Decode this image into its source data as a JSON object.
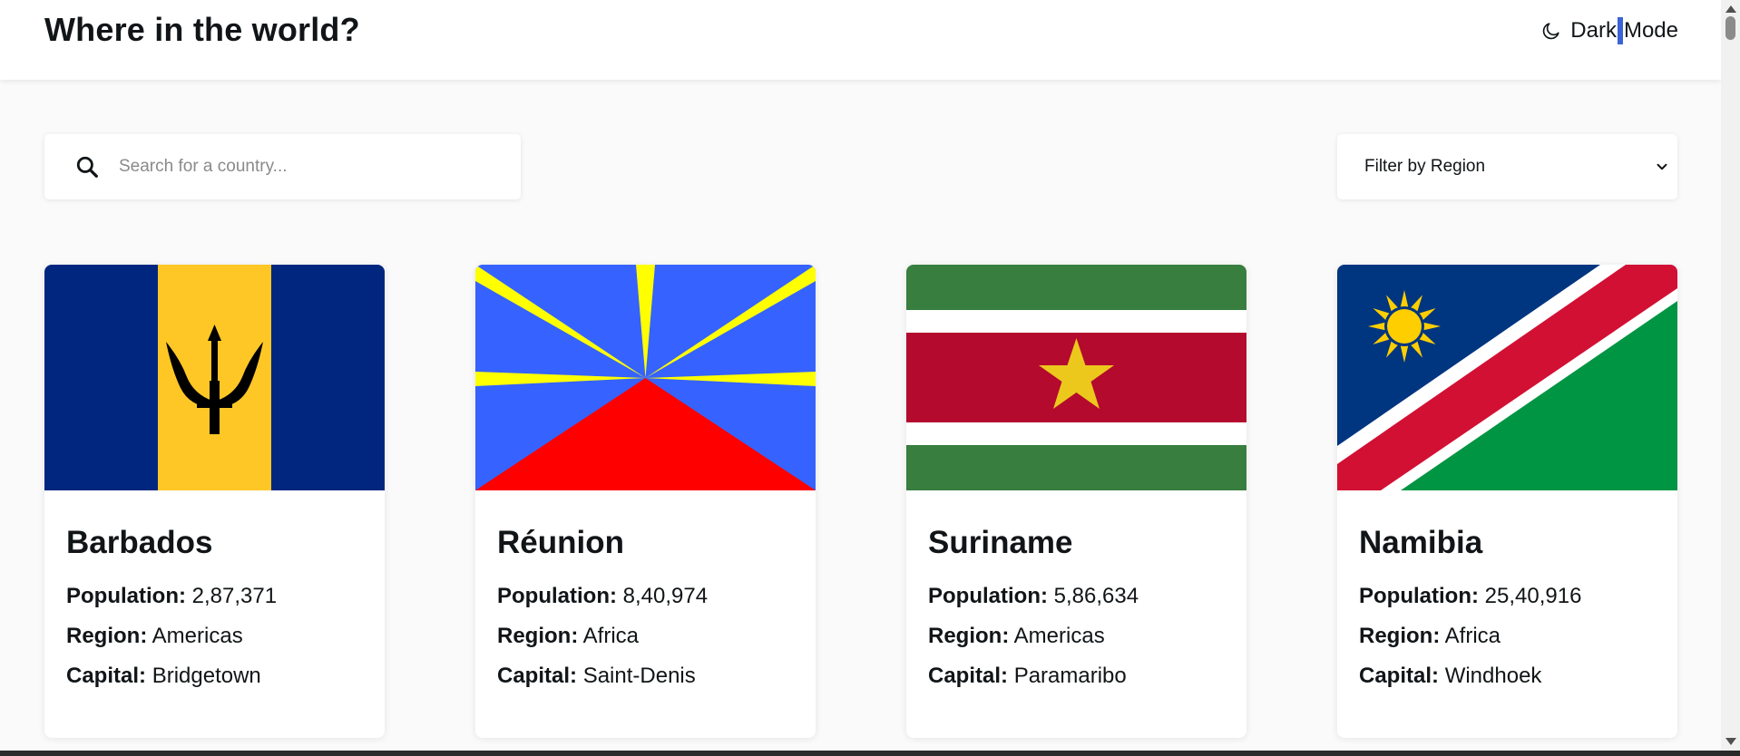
{
  "header": {
    "title": "Where in the world?",
    "mode_word1": "Dark",
    "mode_word2": "Mode",
    "mode_icon": "moon-icon"
  },
  "search": {
    "placeholder": "Search for a country...",
    "icon": "search-icon"
  },
  "filter": {
    "label": "Filter by Region",
    "icon": "chevron-down-icon"
  },
  "labels": {
    "population": "Population:",
    "region": "Region:",
    "capital": "Capital:"
  },
  "countries": [
    {
      "name": "Barbados",
      "population": "2,87,371",
      "region": "Americas",
      "capital": "Bridgetown"
    },
    {
      "name": "Réunion",
      "population": "8,40,974",
      "region": "Africa",
      "capital": "Saint-Denis"
    },
    {
      "name": "Suriname",
      "population": "5,86,634",
      "region": "Americas",
      "capital": "Paramaribo"
    },
    {
      "name": "Namibia",
      "population": "25,40,916",
      "region": "Africa",
      "capital": "Windhoek"
    }
  ],
  "colors": {
    "background": "#fafafa",
    "surface": "#ffffff",
    "text": "#111517",
    "caret": "#3b62d6"
  }
}
